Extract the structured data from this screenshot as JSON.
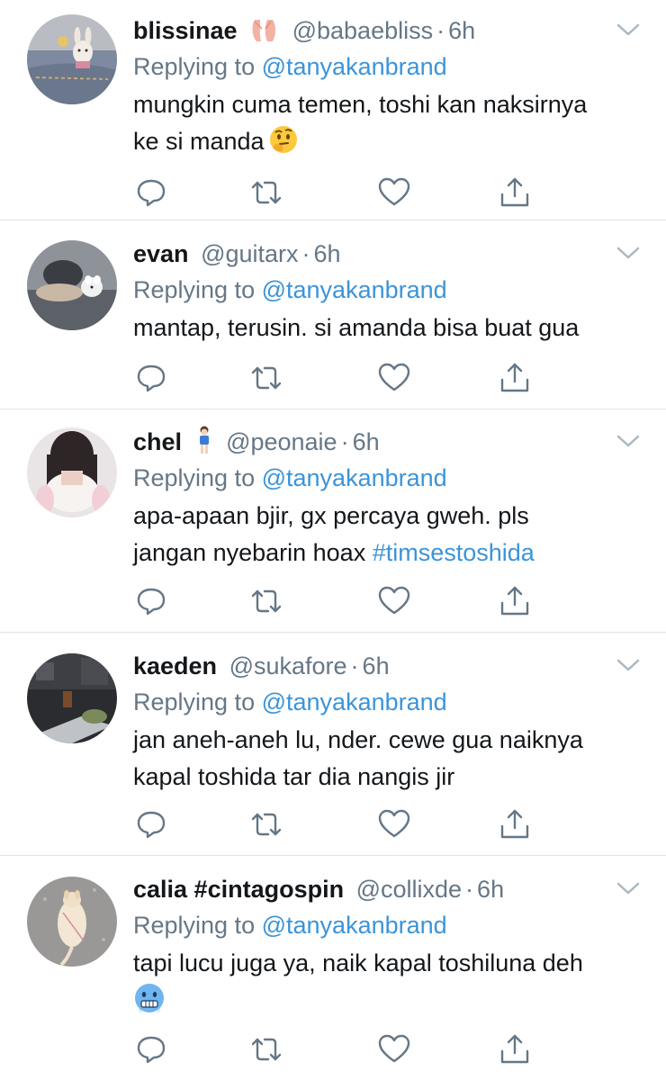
{
  "colors": {
    "text": "#14171a",
    "muted": "#657786",
    "link": "#3b94d9",
    "divider": "#dfe3e8"
  },
  "tweets": [
    {
      "display_name": "blissinae",
      "name_emoji": "ballet-shoes",
      "handle": "@babaebliss",
      "dot": "·",
      "time": "6h",
      "reply_prefix": "Replying to",
      "reply_mention": "@tanyakanbrand",
      "text_line1": "mungkin cuma temen, toshi kan naksirnya",
      "text_line2": "ke si manda",
      "body_emoji": "thinking-face",
      "avatar": "bunny-charm-on-denim"
    },
    {
      "display_name": "evan",
      "handle": "@guitarx",
      "dot": "·",
      "time": "6h",
      "reply_prefix": "Replying to",
      "reply_mention": "@tanyakanbrand",
      "text_line1": "mantap, terusin. si amanda bisa buat gua",
      "avatar": "person-with-white-dog"
    },
    {
      "display_name": "chel",
      "name_emoji": "person-standing",
      "handle": "@peonaie",
      "dot": "·",
      "time": "6h",
      "reply_prefix": "Replying to",
      "reply_mention": "@tanyakanbrand",
      "text_line1": "apa-apaan bjir, gx percaya gweh. pls",
      "text_line2": "jangan nyebarin hoax",
      "hashtag": "#timsestoshida",
      "avatar": "girl-white-dress"
    },
    {
      "display_name": "kaeden",
      "handle": "@sukafore",
      "dot": "·",
      "time": "6h",
      "reply_prefix": "Replying to",
      "reply_mention": "@tanyakanbrand",
      "text_line1": "jan aneh-aneh lu, nder. cewe gua naiknya",
      "text_line2": "kapal toshida tar dia nangis jir",
      "avatar": "laptop-cafe"
    },
    {
      "display_name": "calia #cintagospin",
      "handle": "@collixde",
      "dot": "·",
      "time": "6h",
      "reply_prefix": "Replying to",
      "reply_mention": "@tanyakanbrand",
      "text_line1": "tapi lucu juga ya, naik kapal toshiluna deh",
      "body_emoji": "cold-face",
      "avatar": "cat-on-pavement"
    }
  ],
  "icons": {
    "more": "chevron-down-icon",
    "reply": "reply-icon",
    "retweet": "retweet-icon",
    "like": "heart-icon",
    "share": "share-icon"
  }
}
